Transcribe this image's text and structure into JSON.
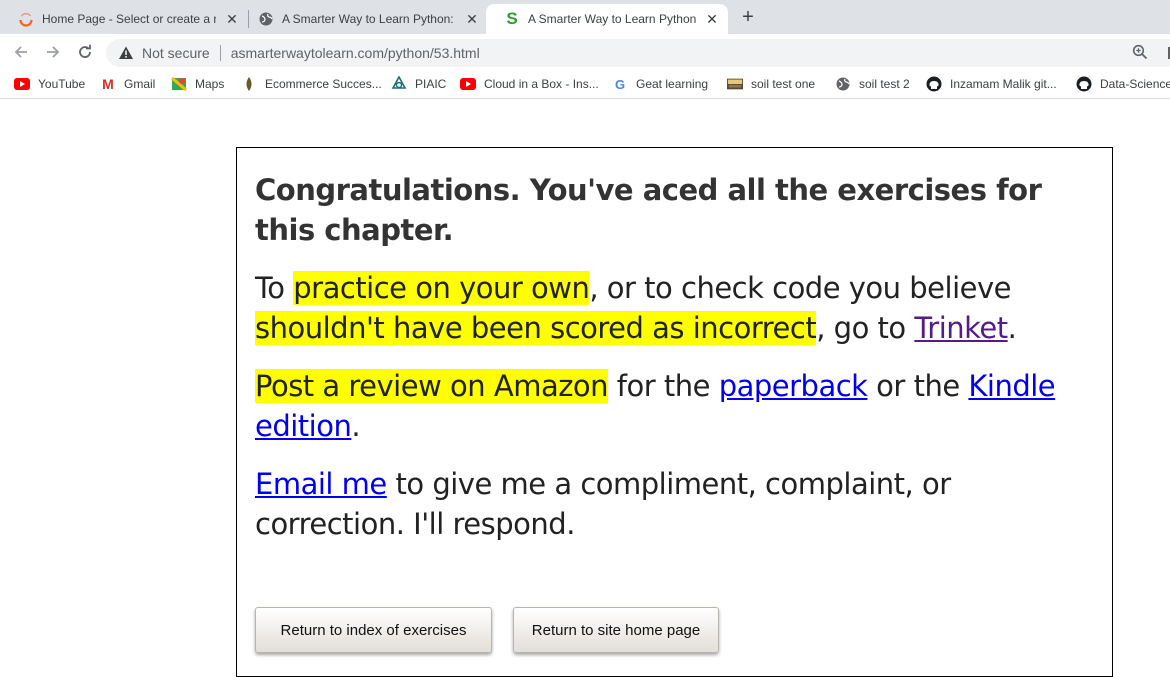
{
  "browser": {
    "tabs": [
      {
        "title": "Home Page - Select or create a n",
        "icon": "orange-arc-icon"
      },
      {
        "title": "A Smarter Way to Learn Python: L",
        "icon": "globe-icon"
      },
      {
        "title": "A Smarter Way to Learn Python -",
        "icon": "green-s-icon",
        "active": true
      }
    ],
    "new_tab": "+",
    "close_glyph": "✕",
    "security_label": "Not secure",
    "url": "asmarterwaytolearn.com/python/53.html",
    "bookmarks": [
      {
        "label": "YouTube",
        "icon": "youtube-icon"
      },
      {
        "label": "Gmail",
        "icon": "gmail-icon"
      },
      {
        "label": "Maps",
        "icon": "maps-icon"
      },
      {
        "label": "Ecommerce Succes...",
        "icon": "leaf-icon"
      },
      {
        "label": "PIAIC",
        "icon": "piaic-icon"
      },
      {
        "label": "Cloud in a Box - Ins...",
        "icon": "youtube-icon"
      },
      {
        "label": "Geat learning",
        "icon": "google-icon"
      },
      {
        "label": "soil test one",
        "icon": "stp-icon"
      },
      {
        "label": "soil test 2",
        "icon": "globe-icon"
      },
      {
        "label": "Inzamam Malik git...",
        "icon": "github-icon"
      },
      {
        "label": "Data-Science",
        "icon": "github-icon"
      }
    ]
  },
  "page": {
    "heading": "Congratulations. You've aced all the exercises for this chapter.",
    "p1": {
      "t1": "To ",
      "hl1": "practice on your own",
      "t2": ", or to check code you believe ",
      "hl2": "shouldn't have been scored as incorrect",
      "t3": ", go to ",
      "link": "Trinket",
      "t4": "."
    },
    "p2": {
      "hl": "Post a review on Amazon",
      "t1": " for the ",
      "link1": "paperback",
      "t2": " or the ",
      "link2": "Kindle edition",
      "t3": "."
    },
    "p3": {
      "link": "Email me",
      "t1": " to give me a compliment, complaint, or correction. I'll respond."
    },
    "buttons": {
      "index": "Return to index of exercises",
      "home": "Return to site home page"
    }
  },
  "colors": {
    "highlight": "#ffff00",
    "link": "#0000ee",
    "visited_link": "#551a8b",
    "tab_strip": "#dee1e6"
  }
}
